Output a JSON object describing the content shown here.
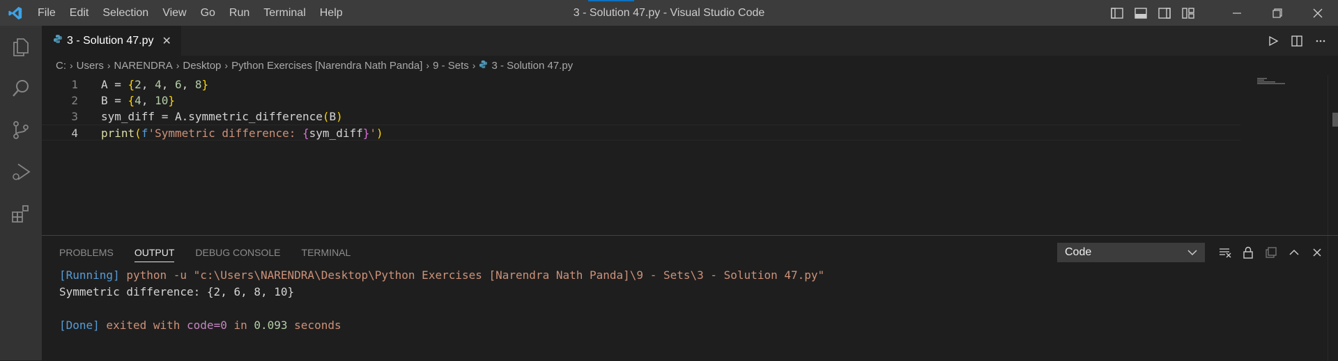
{
  "titlebar": {
    "menu": [
      "File",
      "Edit",
      "Selection",
      "View",
      "Go",
      "Run",
      "Terminal",
      "Help"
    ],
    "window_title": "3 - Solution 47.py - Visual Studio Code"
  },
  "tab": {
    "label": "3 - Solution 47.py",
    "close": "✕"
  },
  "breadcrumb": [
    "C:",
    "Users",
    "NARENDRA",
    "Desktop",
    "Python Exercises [Narendra Nath Panda]",
    "9 - Sets",
    "3 - Solution 47.py"
  ],
  "editor": {
    "lines": [
      {
        "num": "1",
        "tokens": [
          {
            "t": "A = ",
            "c": "plain"
          },
          {
            "t": "{",
            "c": "b1"
          },
          {
            "t": "2",
            "c": "num"
          },
          {
            "t": ", ",
            "c": "plain"
          },
          {
            "t": "4",
            "c": "num"
          },
          {
            "t": ", ",
            "c": "plain"
          },
          {
            "t": "6",
            "c": "num"
          },
          {
            "t": ", ",
            "c": "plain"
          },
          {
            "t": "8",
            "c": "num"
          },
          {
            "t": "}",
            "c": "b1"
          }
        ]
      },
      {
        "num": "2",
        "tokens": [
          {
            "t": "B = ",
            "c": "plain"
          },
          {
            "t": "{",
            "c": "b1"
          },
          {
            "t": "4",
            "c": "num"
          },
          {
            "t": ", ",
            "c": "plain"
          },
          {
            "t": "10",
            "c": "num"
          },
          {
            "t": "}",
            "c": "b1"
          }
        ]
      },
      {
        "num": "3",
        "tokens": [
          {
            "t": "sym_diff = A.",
            "c": "plain"
          },
          {
            "t": "symmetric_difference",
            "c": "plain"
          },
          {
            "t": "(",
            "c": "b1"
          },
          {
            "t": "B",
            "c": "plain"
          },
          {
            "t": ")",
            "c": "b1"
          }
        ]
      },
      {
        "num": "4",
        "tokens": [
          {
            "t": "print",
            "c": "kw-fn"
          },
          {
            "t": "(",
            "c": "b1"
          },
          {
            "t": "f",
            "c": "fpre"
          },
          {
            "t": "'Symmetric difference: ",
            "c": "str"
          },
          {
            "t": "{",
            "c": "b2"
          },
          {
            "t": "sym_diff",
            "c": "plain"
          },
          {
            "t": "}",
            "c": "b2"
          },
          {
            "t": "'",
            "c": "str"
          },
          {
            "t": ")",
            "c": "b1"
          }
        ]
      }
    ]
  },
  "panel": {
    "tabs": [
      "PROBLEMS",
      "OUTPUT",
      "DEBUG CONSOLE",
      "TERMINAL"
    ],
    "active_tab": "OUTPUT",
    "select_value": "Code",
    "output": [
      [
        {
          "t": "[Running]",
          "c": "o-blue"
        },
        {
          "t": " python -u \"c:\\Users\\NARENDRA\\Desktop\\Python Exercises [Narendra Nath Panda]\\9 - Sets\\3 - Solution 47.py\"",
          "c": "o-orange"
        }
      ],
      [
        {
          "t": "Symmetric difference: {2, 6, 8, 10}",
          "c": "o-white"
        }
      ],
      [
        {
          "t": " ",
          "c": "o-white"
        }
      ],
      [
        {
          "t": "[Done]",
          "c": "o-blue"
        },
        {
          "t": " exited with ",
          "c": "o-orange"
        },
        {
          "t": "code=0",
          "c": "o-purple"
        },
        {
          "t": " in ",
          "c": "o-orange"
        },
        {
          "t": "0.093",
          "c": "o-green"
        },
        {
          "t": " seconds",
          "c": "o-orange"
        }
      ]
    ]
  },
  "colors": {
    "accent": "#0e70c0",
    "titlebar": "#3c3c3c",
    "activitybar": "#333333",
    "editor": "#1e1e1e"
  }
}
